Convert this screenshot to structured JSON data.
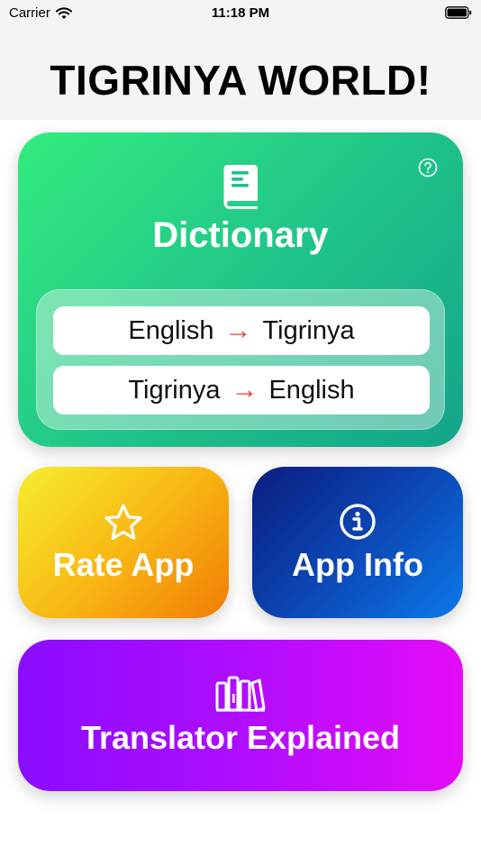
{
  "status_bar": {
    "carrier": "Carrier",
    "time": "11:18 PM"
  },
  "header": {
    "title": "TIGRINYA WORLD!"
  },
  "dictionary": {
    "title": "Dictionary",
    "icon": "book-icon",
    "help_icon": "question-circle-icon",
    "directions": [
      {
        "from": "English",
        "to": "Tigrinya"
      },
      {
        "from": "Tigrinya",
        "to": "English"
      }
    ]
  },
  "rate_app": {
    "label": "Rate App",
    "icon": "star-icon"
  },
  "app_info": {
    "label": "App Info",
    "icon": "info-circle-icon"
  },
  "translator": {
    "label": "Translator Explained",
    "icon": "books-icon"
  },
  "colors": {
    "arrow": "#ee3b2f",
    "dictionary_gradient": [
      "#33ec7e",
      "#14a38a"
    ],
    "rate_gradient": [
      "#f6ee2d",
      "#f17d06"
    ],
    "info_gradient": [
      "#0a1d7f",
      "#0d79e8"
    ],
    "translator_gradient": [
      "#8a0cff",
      "#e40cf6"
    ]
  }
}
